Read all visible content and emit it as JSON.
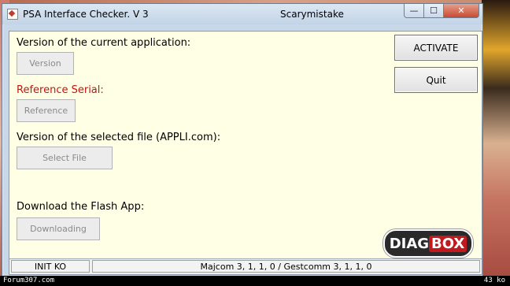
{
  "window": {
    "title": "PSA Interface Checker. V 3",
    "subtitle": "Scarymistake",
    "controls": {
      "minimize": "—",
      "maximize": "☐",
      "close": "✕"
    }
  },
  "sections": {
    "version_label": "Version of the current application:",
    "version_button": "Version",
    "reference_label": "Reference Serial:",
    "reference_button": "Reference",
    "file_label": "Version of the selected file (APPLI.com):",
    "file_button": "Select File",
    "download_label": "Download the Flash App:",
    "download_button": "Downloading"
  },
  "actions": {
    "activate": "ACTIVATE",
    "quit": "Quit"
  },
  "logo": {
    "part1": "DIAG",
    "part2": "BOX"
  },
  "status": {
    "left": "INIT KO",
    "right": "Majcom 3, 1, 1, 0 / Gestcomm 3, 1, 1, 0"
  },
  "watermark": {
    "left": "Forum307.com",
    "right": "43 ko"
  },
  "colors": {
    "reference_label": "#c5130f",
    "client_bg": "#ffffe6",
    "logo_accent": "#c11a1e"
  }
}
